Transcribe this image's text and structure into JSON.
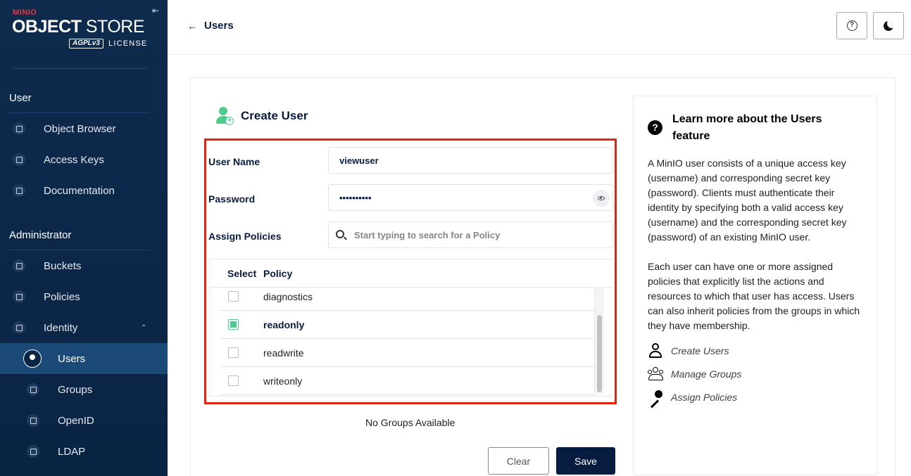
{
  "brand": {
    "company": "MINIO",
    "product_bold": "OBJECT",
    "product_thin": "STORE",
    "license_badge": "AGPLv3",
    "license_label": "LICENSE"
  },
  "sidebar": {
    "collapse_icon": "collapse-left-icon",
    "user_section": "User",
    "user_items": [
      {
        "label": "Object Browser",
        "icon": "object-browser-icon"
      },
      {
        "label": "Access Keys",
        "icon": "access-keys-icon"
      },
      {
        "label": "Documentation",
        "icon": "documentation-icon"
      }
    ],
    "admin_section": "Administrator",
    "admin_items": [
      {
        "label": "Buckets",
        "icon": "bucket-icon"
      },
      {
        "label": "Policies",
        "icon": "policies-icon"
      },
      {
        "label": "Identity",
        "icon": "identity-icon",
        "expanded": true
      }
    ],
    "identity_sub": [
      {
        "label": "Users",
        "icon": "user-icon",
        "active": true
      },
      {
        "label": "Groups",
        "icon": "groups-icon"
      },
      {
        "label": "OpenID",
        "icon": "openid-icon"
      },
      {
        "label": "LDAP",
        "icon": "ldap-icon"
      }
    ]
  },
  "header": {
    "back_label": "Users",
    "help_icon": "help-icon",
    "theme_icon": "dark-mode-icon"
  },
  "form": {
    "title": "Create User",
    "username_label": "User Name",
    "username_value": "viewuser",
    "password_label": "Password",
    "password_value": "••••••••••",
    "policies_label": "Assign Policies",
    "policies_placeholder": "Start typing to search for a Policy",
    "table_headers": {
      "select": "Select",
      "policy": "Policy"
    },
    "policies": [
      {
        "name": "diagnostics",
        "checked": false
      },
      {
        "name": "readonly",
        "checked": true
      },
      {
        "name": "readwrite",
        "checked": false
      },
      {
        "name": "writeonly",
        "checked": false
      }
    ],
    "no_groups": "No Groups Available",
    "clear_label": "Clear",
    "save_label": "Save"
  },
  "help": {
    "title": "Learn more about the Users feature",
    "para1": "A MinIO user consists of a unique access key (username) and corresponding secret key (password). Clients must authenticate their identity by specifying both a valid access key (username) and the corresponding secret key (password) of an existing MinIO user.",
    "para2": "Each user can have one or more assigned policies that explicitly list the actions and resources to which that user has access. Users can also inherit policies from the groups in which they have membership.",
    "links": [
      {
        "label": "Create Users",
        "icon": "user-outline-icon"
      },
      {
        "label": "Manage Groups",
        "icon": "group-outline-icon"
      },
      {
        "label": "Assign Policies",
        "icon": "key-icon"
      }
    ]
  },
  "colors": {
    "sidebar_bg": "#0e2a4d",
    "active_item": "#1c4a78",
    "accent_green": "#4ccb8d",
    "highlight_red": "#e4220e",
    "primary_dark": "#081c42"
  }
}
